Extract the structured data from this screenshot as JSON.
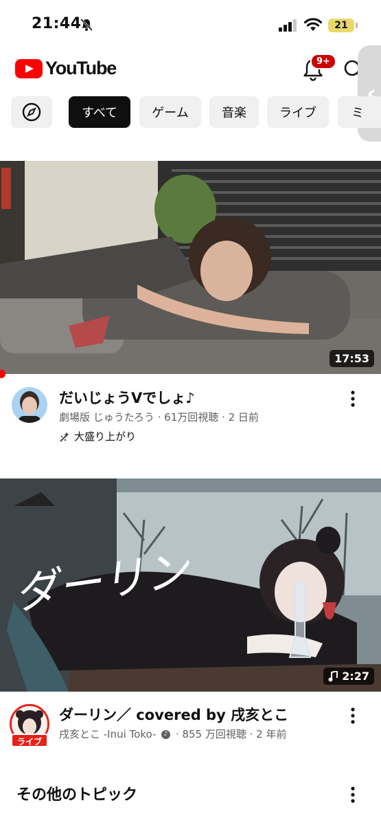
{
  "status_bar": {
    "time": "21:44",
    "battery": "21",
    "silent_icon": "bell-slash-icon"
  },
  "header": {
    "logo_text": "YouTube",
    "notification_badge": "9+",
    "brand_color": "#ff0000"
  },
  "chips": [
    {
      "label": "すべて",
      "active": true
    },
    {
      "label": "ゲーム",
      "active": false
    },
    {
      "label": "音楽",
      "active": false
    },
    {
      "label": "ライブ",
      "active": false
    },
    {
      "label": "ミ",
      "active": false
    }
  ],
  "videos": [
    {
      "title": "だいじょうVでしょ♪",
      "meta": "劇場版 じゅうたろう · 61万回視聴 · 2 日前",
      "trending": "大盛り上がり",
      "duration": "17:53"
    },
    {
      "title": "ダーリン／ covered by 戌亥とこ",
      "channel": "戌亥とこ -Inui Toko-",
      "stats": "· 855 万回視聴 · 2 年前",
      "duration": "2:27",
      "live_label": "ライブ",
      "thumbnail_text": "ダーリン"
    }
  ],
  "section": {
    "title": "その他のトピック"
  }
}
